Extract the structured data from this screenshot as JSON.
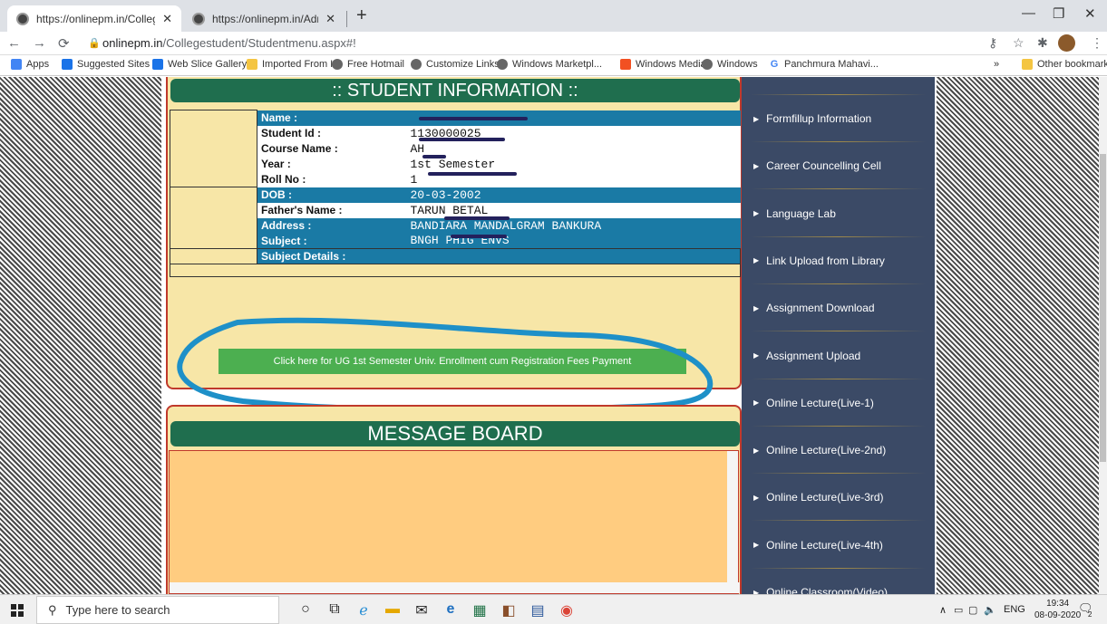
{
  "browser": {
    "tabs": [
      {
        "title": "https://onlinepm.in/Collegestude"
      },
      {
        "title": "https://onlinepm.in/Admission/V"
      }
    ],
    "url_domain": "onlinepm.in",
    "url_path": "/Collegestudent/Studentmenu.aspx#!",
    "bookmarks": [
      "Apps",
      "Suggested Sites",
      "Web Slice Gallery",
      "Imported From IE",
      "Free Hotmail",
      "Customize Links",
      "Windows Marketpl...",
      "Windows Media",
      "Windows",
      "Panchmura Mahavi..."
    ],
    "bookmarks_more": "»",
    "other_bookmarks": "Other bookmarks"
  },
  "student_info": {
    "header": ":: STUDENT INFORMATION ::",
    "rows": [
      {
        "label": "Name :",
        "value": "",
        "style": "blue"
      },
      {
        "label": "Student Id :",
        "value": "1130000025",
        "style": "white"
      },
      {
        "label": "Course Name :",
        "value": "AH",
        "style": "white"
      },
      {
        "label": "Year :",
        "value": "1st Semester",
        "style": "white"
      },
      {
        "label": "Roll No :",
        "value": "1",
        "style": "white"
      },
      {
        "label": "DOB :",
        "value": "20-03-2002",
        "style": "blue"
      },
      {
        "label": "Father's Name :",
        "value": "TARUN BETAL",
        "style": "white"
      },
      {
        "label": "Address :",
        "value": "BANDIARA MANDALGRAM BANKURA",
        "style": "blue"
      },
      {
        "label": "Subject :",
        "value": "BNGH PHIG ENVS",
        "style": "blue"
      },
      {
        "label": "Subject Details :",
        "value": "",
        "style": "blue"
      }
    ],
    "pay_button": "Click here for UG 1st Semester Univ. Enrollment cum Registration Fees Payment"
  },
  "message_board": {
    "header": "MESSAGE BOARD"
  },
  "menu": {
    "items": [
      "Formfillup Information",
      "Career Councelling Cell",
      "Language Lab",
      "Link Upload from Library",
      "Assignment Download",
      "Assignment Upload",
      "Online Lecture(Live-1)",
      "Online Lecture(Live-2nd)",
      "Online Lecture(Live-3rd)",
      "Online Lecture(Live-4th)",
      "Online Classroom(Video)"
    ]
  },
  "taskbar": {
    "search_placeholder": "Type here to search",
    "language": "ENG",
    "time": "19:34",
    "date": "08-09-2020",
    "notification_count": "2"
  },
  "colors": {
    "accent_green": "#1f6e4e",
    "row_blue": "#1a7aa5",
    "menu_bg": "#3b4a66",
    "panel": "#f7e6a7",
    "button_green": "#4caf50",
    "annotation": "#1e90c8"
  }
}
